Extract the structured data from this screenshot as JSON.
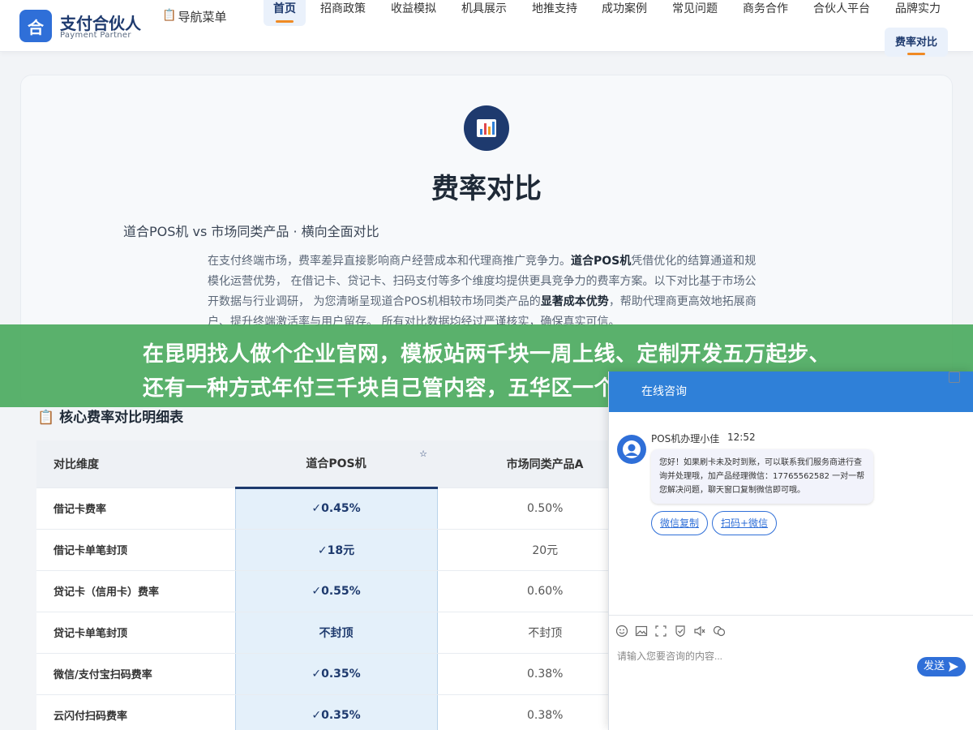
{
  "header": {
    "logo_char": "合",
    "brand": "支付合伙人",
    "brand_sub": "Payment Partner",
    "nav_menu_icon": "clipboard-icon",
    "nav_menu_label": "导航菜单",
    "nav_items": [
      "首页",
      "招商政策",
      "收益模拟",
      "机具展示",
      "地推支持",
      "成功案例",
      "常见问题",
      "商务合作",
      "合伙人平台",
      "品牌实力",
      "费率对比"
    ],
    "active_color": "#f08a24"
  },
  "hero": {
    "icon": "bar-chart-icon",
    "title": "费率对比",
    "subtitle": "道合POS机 vs 市场同类产品 · 横向全面对比",
    "desc_1": "在支付终端市场，费率差异直接影响商户经营成本和代理商推广竞争力。",
    "desc_2": "道合POS机",
    "desc_3": "凭借优化的结算通道和规模化运营优势， 在借记卡、贷记卡、扫码支付等多个维度均提供更具竞争力的费率方案。以下对比基于市场公开数据与行业调研， 为您清晰呈现道合POS机相较市场同类产品的",
    "desc_4": "显著成本优势",
    "desc_5": "，帮助代理商更高效地拓展商户、提升终端激活率与用户留存。 所有对比数据均经过严谨核实，确保真实可信。"
  },
  "banner": {
    "line1": "在昆明找人做个企业官网，模板站两千块一周上线、定制开发五万起步、",
    "line2": "还有一种方式年付三千块自己管内容，五华区一个干了八年的项目经理说",
    "color": "#4caa60"
  },
  "table": {
    "title_icon": "clipboard-icon",
    "title": "核心费率对比明细表",
    "columns": [
      "对比维度",
      "道合POS机",
      "市场同类产品A"
    ],
    "highlight_color": "#e4f0fa",
    "rows": [
      {
        "dim": "借记卡费率",
        "ours": "✓0.45%",
        "other": "0.50%"
      },
      {
        "dim": "借记卡单笔封顶",
        "ours": "✓18元",
        "other": "20元"
      },
      {
        "dim": "贷记卡（信用卡）费率",
        "ours": "✓0.55%",
        "other": "0.60%"
      },
      {
        "dim": "贷记卡单笔封顶",
        "ours": "不封顶",
        "other": "不封顶"
      },
      {
        "dim": "微信/支付宝扫码费率",
        "ours": "✓0.35%",
        "other": "0.38%"
      },
      {
        "dim": "云闪付扫码费率",
        "ours": "✓0.35%",
        "other": "0.38%"
      }
    ]
  },
  "chat": {
    "header_text": "在线咨询",
    "agent_name": "POS机办理小佳",
    "time": "12:52",
    "message": "您好！如果刷卡未及时到账，可以联系我们服务商进行查询并处理哦，加产品经理微信：17765562582 一对一帮您解决问题，聊天窗口复制微信即可哦。",
    "btn_copy": "微信复制",
    "btn_scan": "扫码+微信",
    "input_placeholder": "请输入您要咨询的内容...",
    "send_label": "发送",
    "tools": [
      "emoji-icon",
      "image-icon",
      "screenshot-icon",
      "rate-icon",
      "voice-icon",
      "history-icon"
    ],
    "accent": "#2f6fd8"
  }
}
